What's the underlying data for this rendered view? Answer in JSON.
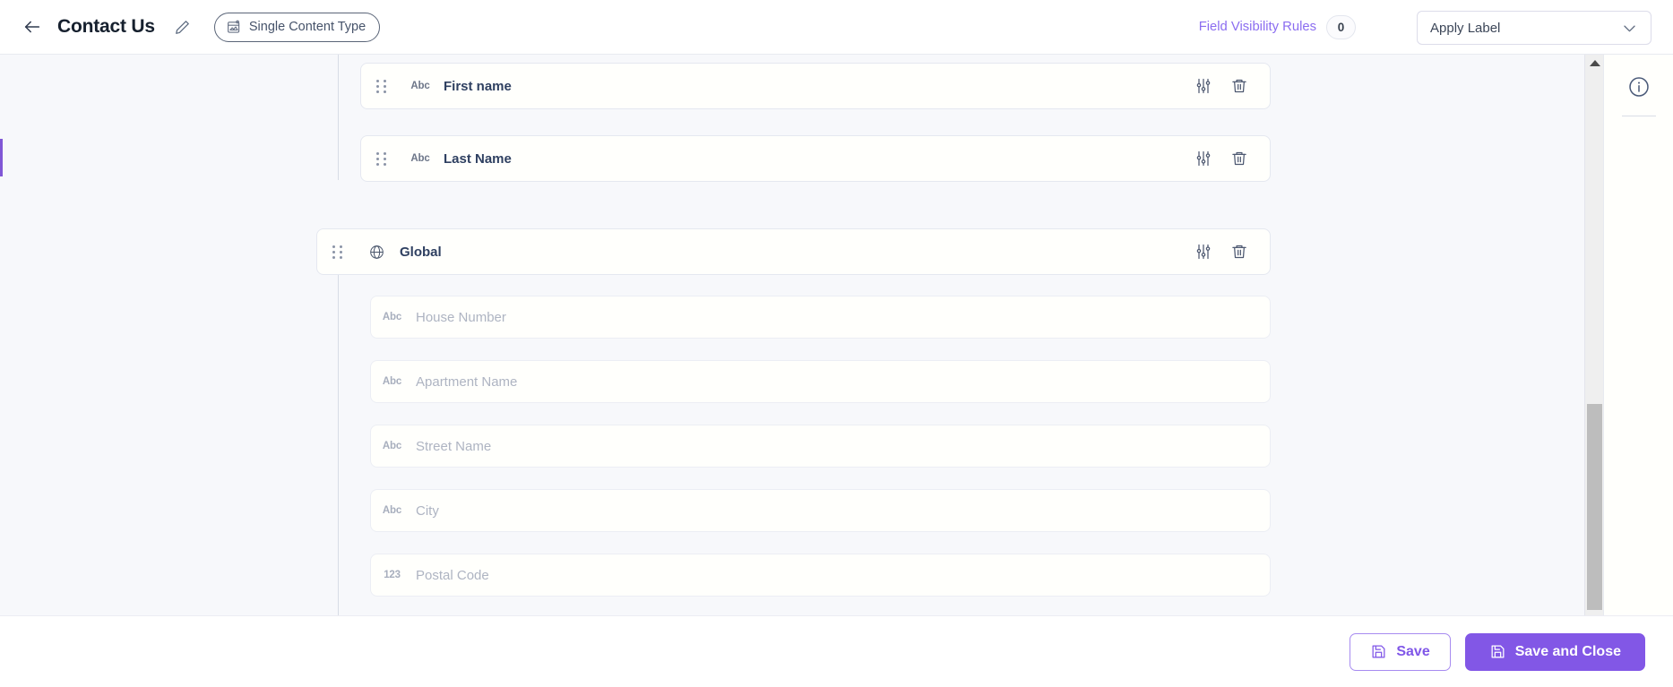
{
  "header": {
    "back_icon": "arrow-left-icon",
    "title": "Contact Us",
    "edit_icon": "pencil-icon",
    "content_type_badge": {
      "icon": "content-type-icon",
      "label": "Single Content Type"
    },
    "field_visibility_rules": {
      "label": "Field Visibility Rules",
      "count": "0"
    },
    "apply_label": {
      "value": "Apply Label",
      "chevron_icon": "chevron-down-icon"
    }
  },
  "canvas": {
    "field_cards": [
      {
        "grip_icon": "drag-handle-icon",
        "type_icon": "Abc",
        "type_name": "text-type-icon",
        "name": "First name",
        "settings_icon": "sliders-icon",
        "delete_icon": "trash-icon"
      },
      {
        "grip_icon": "drag-handle-icon",
        "type_icon": "Abc",
        "type_name": "text-type-icon",
        "name": "Last Name",
        "settings_icon": "sliders-icon",
        "delete_icon": "trash-icon"
      }
    ],
    "group_card": {
      "grip_icon": "drag-handle-icon",
      "type_name": "globe-icon",
      "name": "Global",
      "settings_icon": "sliders-icon",
      "delete_icon": "trash-icon"
    },
    "input_rows": [
      {
        "type_icon": "Abc",
        "type_name": "text-type-icon",
        "placeholder": "House Number"
      },
      {
        "type_icon": "Abc",
        "type_name": "text-type-icon",
        "placeholder": "Apartment Name"
      },
      {
        "type_icon": "Abc",
        "type_name": "text-type-icon",
        "placeholder": "Street Name"
      },
      {
        "type_icon": "Abc",
        "type_name": "text-type-icon",
        "placeholder": "City"
      },
      {
        "type_icon": "123",
        "type_name": "number-type-icon",
        "placeholder": "Postal Code"
      }
    ],
    "scrollbar": {
      "up_arrow_icon": "scroll-up-arrow-icon",
      "down_arrow_icon": "scroll-down-arrow-icon",
      "thumb": "scrollbar-thumb"
    }
  },
  "right_rail": {
    "info_icon": "info-circle-icon"
  },
  "footer": {
    "save": {
      "icon": "save-floppy-icon",
      "label": "Save"
    },
    "save_and_close": {
      "icon": "save-floppy-icon",
      "label": "Save and Close"
    }
  },
  "colors": {
    "accent_purple": "#8257e6",
    "link_purple": "#8b6df0",
    "canvas_bg": "#f7f8fb",
    "card_border": "#e5e8f0",
    "field_label": "#2f4061",
    "placeholder": "#aeb4c2"
  }
}
